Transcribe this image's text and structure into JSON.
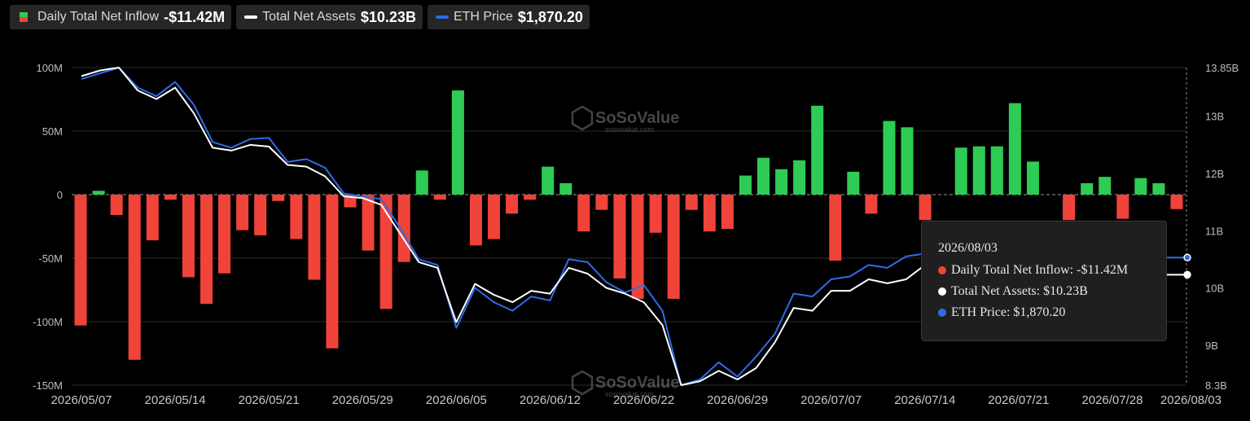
{
  "legend": {
    "inflow": {
      "label": "Daily Total Net Inflow",
      "value": "-$11.42M"
    },
    "assets": {
      "label": "Total Net Assets",
      "value": "$10.23B"
    },
    "eth": {
      "label": "ETH Price",
      "value": "$1,870.20"
    }
  },
  "watermark": {
    "brand": "SoSoValue",
    "url": "sosovalue.com"
  },
  "tooltip": {
    "date": "2026/08/03",
    "inflow": "Daily Total Net Inflow: -$11.42M",
    "assets": "Total Net Assets: $10.23B",
    "eth": "ETH Price: $1,870.20"
  },
  "colors": {
    "positive": "#2ecc55",
    "negative": "#f0433a",
    "assets_line": "#ffffff",
    "eth_line": "#2f6be6",
    "background": "#000000"
  },
  "chart_data": {
    "type": "bar",
    "x_tick_labels": [
      "2026/05/07",
      "2026/05/14",
      "2026/05/21",
      "2026/05/29",
      "2026/06/05",
      "2026/06/12",
      "2026/06/22",
      "2026/06/29",
      "2026/07/07",
      "2026/07/14",
      "2026/07/21",
      "2026/07/28",
      "2026/08/03"
    ],
    "x_tick_index": [
      0,
      5,
      10,
      15,
      20,
      25,
      30,
      35,
      40,
      45,
      50,
      55,
      59
    ],
    "left_axis": {
      "labels": [
        "100M",
        "50M",
        "0",
        "-50M",
        "-100M",
        "-150M"
      ],
      "values": [
        100,
        50,
        0,
        -50,
        -100,
        -150
      ],
      "ylim": [
        -150,
        100
      ]
    },
    "right_axis": {
      "labels": [
        "13.85B",
        "13B",
        "12B",
        "11B",
        "10B",
        "9B",
        "8.3B"
      ],
      "values": [
        13.85,
        13,
        12,
        11,
        10,
        9,
        8.3
      ],
      "ylim": [
        8.3,
        13.85
      ]
    },
    "series": [
      {
        "name": "Daily Total Net Inflow",
        "kind": "bar",
        "values": [
          -103,
          3,
          -16,
          -130,
          -36,
          -4,
          -65,
          -86,
          -62,
          -28,
          -32,
          -5,
          -35,
          -67,
          -121,
          -10,
          -44,
          -90,
          -53,
          19,
          -4,
          82,
          -40,
          -35,
          -15,
          -4,
          22,
          9,
          -29,
          -12,
          -66,
          -82,
          -30,
          -82,
          -12,
          -29,
          -27,
          15,
          29,
          20,
          27,
          70,
          -52,
          18,
          -15,
          58,
          53,
          -20,
          0,
          37,
          38,
          38,
          72,
          26,
          0,
          -20,
          9,
          14,
          -19,
          13,
          9,
          -11.42
        ]
      },
      {
        "name": "Total Net Assets",
        "kind": "line",
        "values": [
          13.7,
          13.8,
          13.85,
          13.45,
          13.3,
          13.5,
          13.05,
          12.45,
          12.4,
          12.5,
          12.47,
          12.15,
          12.12,
          11.95,
          11.6,
          11.57,
          11.45,
          10.95,
          10.45,
          10.35,
          9.4,
          10.07,
          9.88,
          9.75,
          9.95,
          9.9,
          10.35,
          10.25,
          10.0,
          9.9,
          9.75,
          9.35,
          8.3,
          8.37,
          8.55,
          8.4,
          8.6,
          9.05,
          9.65,
          9.6,
          9.95,
          9.95,
          10.15,
          10.08,
          10.15,
          10.4,
          10.5,
          10.35,
          10.3,
          10.3,
          10.33,
          10.32,
          10.3,
          10.28,
          10.25,
          10.23,
          10.23,
          10.23,
          10.23,
          10.23
        ]
      },
      {
        "name": "ETH Price",
        "kind": "line",
        "values": [
          13.65,
          13.75,
          13.85,
          13.5,
          13.35,
          13.6,
          13.2,
          12.55,
          12.45,
          12.6,
          12.62,
          12.2,
          12.25,
          12.1,
          11.65,
          11.6,
          11.55,
          11.05,
          10.5,
          10.4,
          9.3,
          10.0,
          9.75,
          9.6,
          9.85,
          9.78,
          10.5,
          10.45,
          10.1,
          9.92,
          10.05,
          9.6,
          8.3,
          8.4,
          8.7,
          8.45,
          8.8,
          9.2,
          9.9,
          9.85,
          10.15,
          10.2,
          10.4,
          10.35,
          10.55,
          10.6,
          10.62,
          10.58,
          10.56,
          10.55,
          10.58,
          10.57,
          10.56,
          10.55,
          10.54,
          10.53,
          10.52,
          10.52,
          10.53,
          10.53
        ]
      }
    ]
  }
}
